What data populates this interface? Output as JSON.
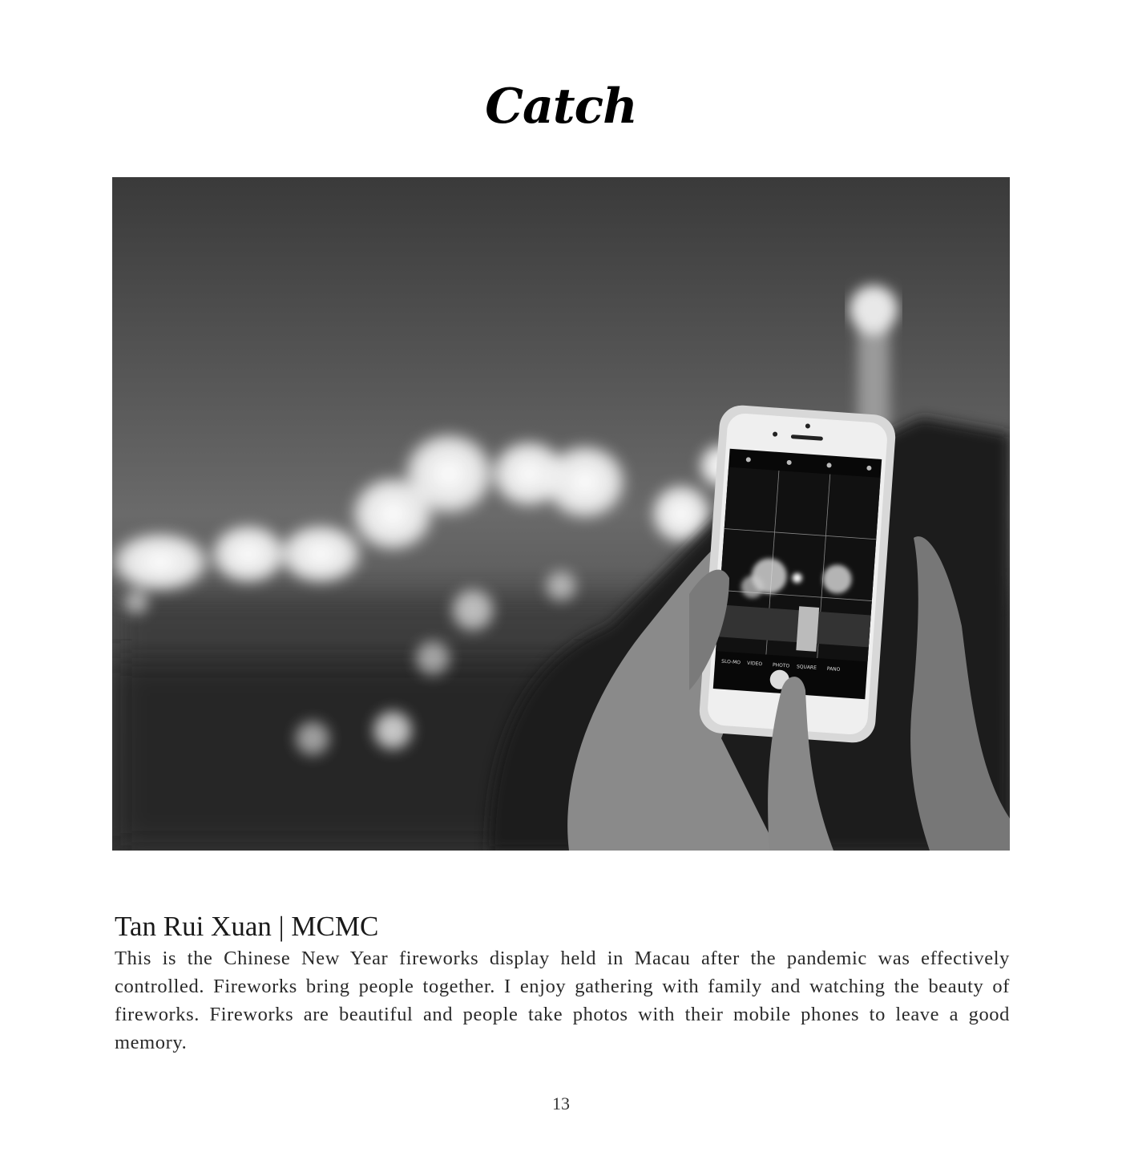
{
  "page": {
    "title": "Catch",
    "author_line": "Tan Rui Xuan | MCMC",
    "caption": "This is the Chinese New Year fireworks display held in Macau after the pandemic was effectively controlled. Fireworks bring people together. I enjoy gathering with family and watching the beauty of fireworks. Fireworks are beautiful and people take photos with their mobile phones to leave a good memory.",
    "page_number": "13"
  },
  "photo": {
    "camera_modes": [
      "SLO-MO",
      "VIDEO",
      "PHOTO",
      "SQUARE",
      "PANO"
    ]
  }
}
